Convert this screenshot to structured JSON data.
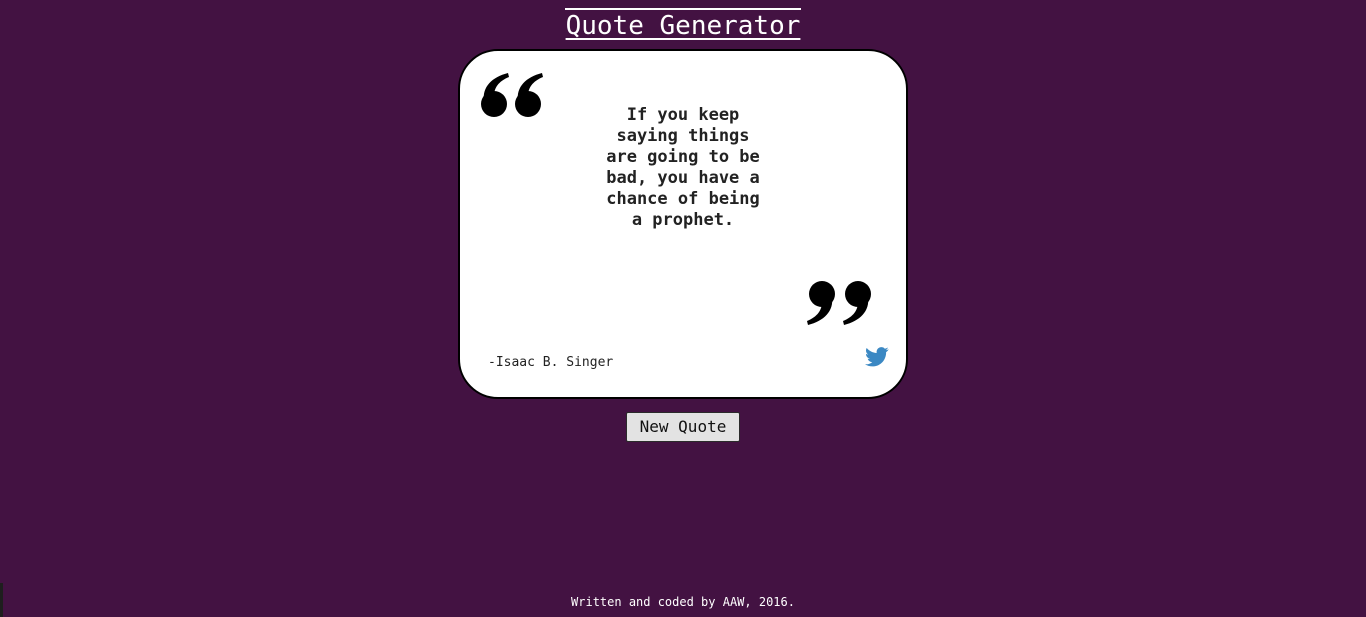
{
  "header": {
    "title": "Quote Generator"
  },
  "quote_card": {
    "open_quote_icon": "open-quote-icon",
    "close_quote_icon": "close-quote-icon",
    "text": "If you keep saying things are going to be bad, you have a chance of being a prophet.",
    "author": "-Isaac B. Singer",
    "share_icon": "twitter-icon",
    "share_icon_color": "#3b88c3"
  },
  "actions": {
    "new_quote_label": "New Quote"
  },
  "footer": {
    "text": "Written and coded by AAW, 2016."
  },
  "colors": {
    "background": "#431242",
    "card": "#ffffff",
    "accent": "#3b88c3"
  }
}
